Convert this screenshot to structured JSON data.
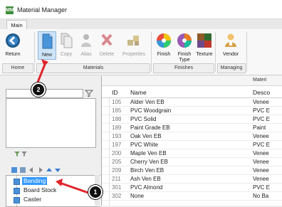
{
  "window": {
    "title": "Material Manager",
    "app_icon": "MM"
  },
  "tabs": [
    {
      "label": "Main"
    }
  ],
  "ribbon": {
    "buttons": [
      {
        "label": "Return",
        "icon": "return-arrow-icon"
      },
      {
        "label": "New",
        "icon": "new-document-icon"
      },
      {
        "label": "Copy",
        "icon": "copy-icon"
      },
      {
        "label": "Alias",
        "icon": "alias-person-icon"
      },
      {
        "label": "Delete",
        "icon": "delete-x-icon"
      },
      {
        "label": "Properties",
        "icon": "properties-icon"
      },
      {
        "label": "Finish",
        "icon": "finish-color-wheel-icon"
      },
      {
        "label": "Finish Type",
        "icon": "finish-type-icon"
      },
      {
        "label": "Texture",
        "icon": "texture-icon"
      },
      {
        "label": "Vendor",
        "icon": "vendor-person-icon"
      }
    ],
    "groups": [
      {
        "label": "Home"
      },
      {
        "label": "Materials"
      },
      {
        "label": "Finishes"
      },
      {
        "label": "Managing"
      }
    ]
  },
  "grid": {
    "top_label": "Materi",
    "columns": [
      {
        "label": "ID"
      },
      {
        "label": "Name"
      },
      {
        "label": "Desco"
      }
    ],
    "rows": [
      {
        "id": "105",
        "name": "Alder Ven EB",
        "desc": "Venee"
      },
      {
        "id": "185",
        "name": "PVC Woodgrain",
        "desc": "PVC E"
      },
      {
        "id": "188",
        "name": "PVC Solid",
        "desc": "PVC E"
      },
      {
        "id": "189",
        "name": "Paint Grade EB",
        "desc": "Paint"
      },
      {
        "id": "193",
        "name": "Oak Ven EB",
        "desc": "Venee"
      },
      {
        "id": "197",
        "name": "PVC White",
        "desc": "PVC E"
      },
      {
        "id": "200",
        "name": "Maple Ven EB",
        "desc": "Venee"
      },
      {
        "id": "205",
        "name": "Cherry Ven EB",
        "desc": "Venee"
      },
      {
        "id": "209",
        "name": "Birch Ven EB",
        "desc": "Venee"
      },
      {
        "id": "211",
        "name": "Ash Ven EB",
        "desc": "Venee"
      },
      {
        "id": "301",
        "name": "PVC Almond",
        "desc": "PVC E"
      },
      {
        "id": "302",
        "name": "None",
        "desc": "No Ba"
      }
    ]
  },
  "tree": {
    "items": [
      {
        "label": "Banding"
      },
      {
        "label": "Board Stock"
      },
      {
        "label": "Caster"
      }
    ]
  },
  "callouts": [
    {
      "number": "1"
    },
    {
      "number": "2"
    }
  ],
  "colors": {
    "accent_red": "#e0242b",
    "selection_blue": "#3399ff"
  }
}
